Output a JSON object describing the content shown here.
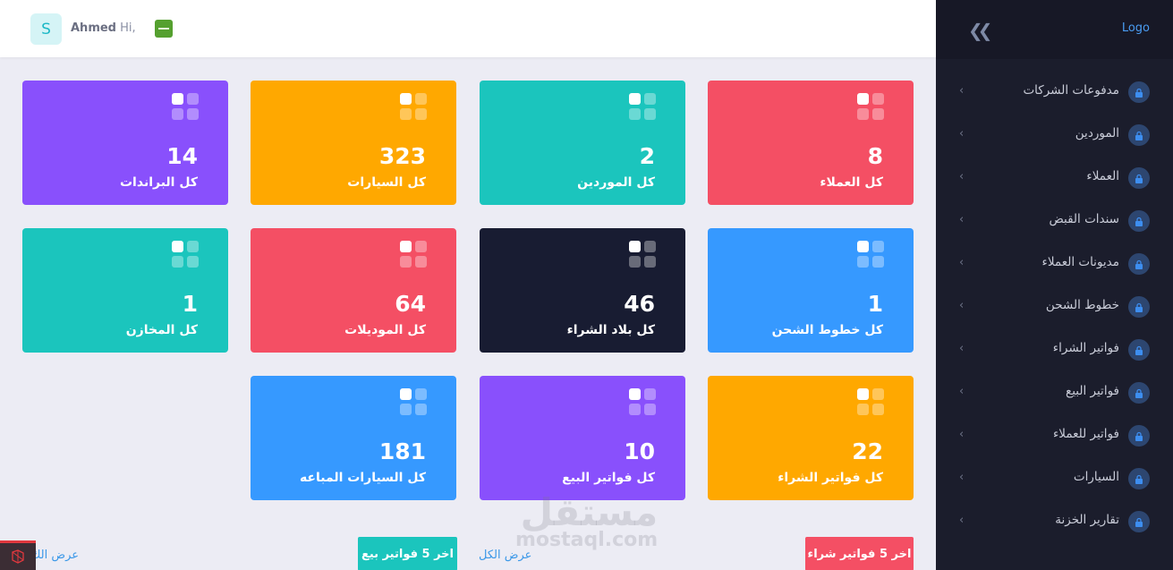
{
  "header": {
    "avatar_initial": "S",
    "greeting": "Hi,",
    "user_name": "Ahmed"
  },
  "sidebar": {
    "logo_text": "Logo",
    "items": [
      {
        "label": "مدفوعات الشركات"
      },
      {
        "label": "الموردين"
      },
      {
        "label": "العملاء"
      },
      {
        "label": "سندات القبض"
      },
      {
        "label": "مديونات العملاء"
      },
      {
        "label": "خطوط الشحن"
      },
      {
        "label": "فواتير الشراء"
      },
      {
        "label": "فواتير البيع"
      },
      {
        "label": "فواتير للعملاء"
      },
      {
        "label": "السيارات"
      },
      {
        "label": "تقارير الخزنة"
      }
    ]
  },
  "cards": [
    {
      "value": "8",
      "label": "كل العملاء",
      "color": "#f44f64"
    },
    {
      "value": "2",
      "label": "كل الموردين",
      "color": "#1bc5bd"
    },
    {
      "value": "323",
      "label": "كل السيارات",
      "color": "#ffa800"
    },
    {
      "value": "14",
      "label": "كل البراندات",
      "color": "#8950fc"
    },
    {
      "value": "1",
      "label": "كل خطوط الشحن",
      "color": "#3699ff"
    },
    {
      "value": "46",
      "label": "كل بلاد الشراء",
      "color": "#181c32"
    },
    {
      "value": "64",
      "label": "كل الموديلات",
      "color": "#f44f64"
    },
    {
      "value": "1",
      "label": "كل المخازن",
      "color": "#1bc5bd"
    },
    {
      "value": "22",
      "label": "كل فواتير الشراء",
      "color": "#ffa800"
    },
    {
      "value": "10",
      "label": "كل فواتير البيع",
      "color": "#8950fc"
    },
    {
      "value": "181",
      "label": "كل السيارات المباعه",
      "color": "#3699ff"
    }
  ],
  "bottom": {
    "purchase_title": "اخر 5 فواتير شراء",
    "sales_title": "اخر 5 فواتير بيع",
    "view_all_1": "عرض الكل",
    "view_all_2": "عرض الك"
  },
  "watermark": {
    "arabic": "مستقل",
    "latin": "mostaql.com"
  }
}
